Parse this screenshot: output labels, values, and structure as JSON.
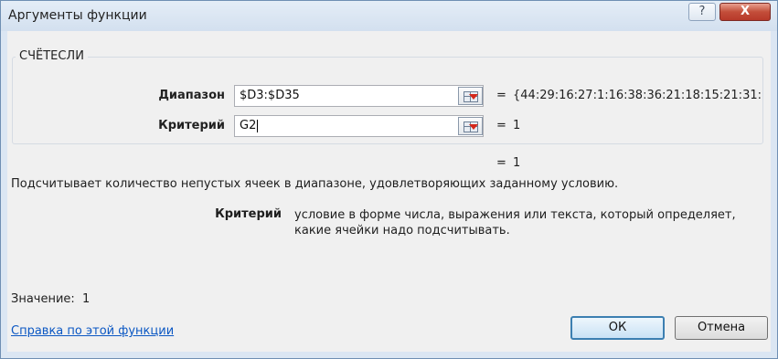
{
  "window": {
    "title": "Аргументы функции",
    "help_icon": "?",
    "close_icon": "X"
  },
  "function": {
    "name": "СЧЁТЕСЛИ"
  },
  "args": [
    {
      "label": "Диапазон",
      "value": "$D3:$D35",
      "eq": "=",
      "result": "{44:29:16:27:1:16:38:36:21:18:15:21:31:"
    },
    {
      "label": "Критерий",
      "value": "G2",
      "eq": "=",
      "result": "1"
    }
  ],
  "formula_result": {
    "eq": "=",
    "value": "1"
  },
  "description": "Подсчитывает количество непустых ячеек в диапазоне, удовлетворяющих заданному условию.",
  "parameter_help": {
    "name": "Критерий",
    "text": "условие в форме числа, выражения или текста, который определяет, какие ячейки надо подсчитывать."
  },
  "value": {
    "label": "Значение:",
    "text": "1"
  },
  "help_link": "Справка по этой функции",
  "buttons": {
    "ok": "ОК",
    "cancel": "Отмена"
  }
}
